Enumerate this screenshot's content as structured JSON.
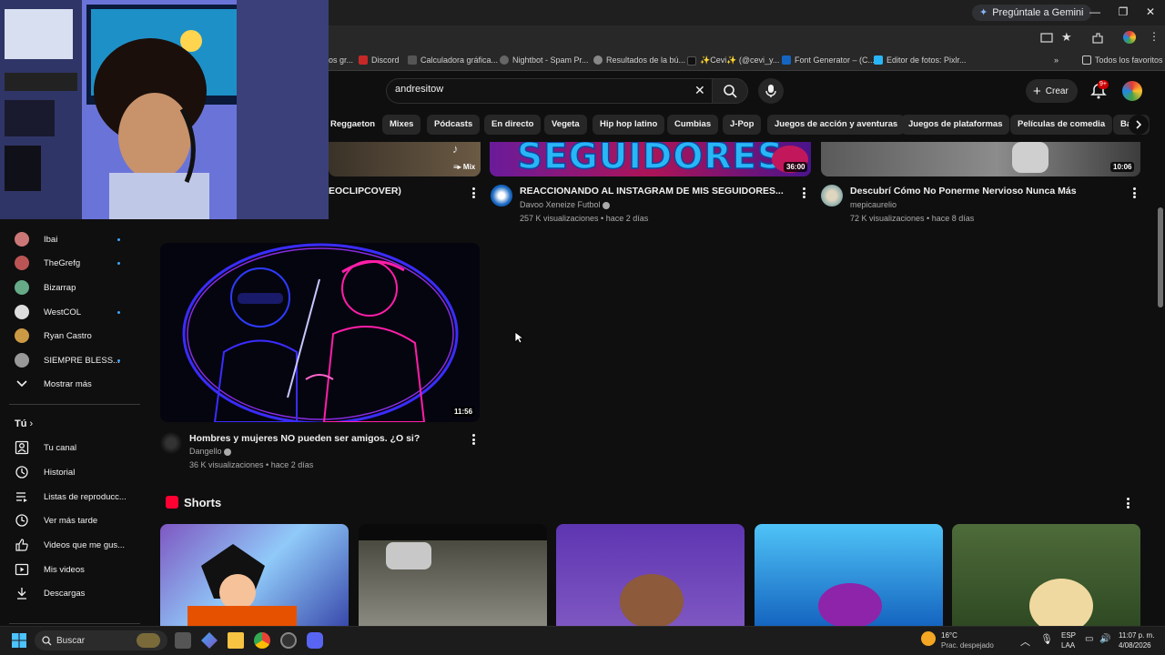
{
  "browser": {
    "gemini_label": "Pregúntale a Gemini",
    "bookmarks": [
      {
        "label": "os gr...",
        "color": "#444"
      },
      {
        "label": "Discord",
        "color": "#c62828"
      },
      {
        "label": "Calculadora gráfica...",
        "color": "#555"
      },
      {
        "label": "Nightbot - Spam Pr...",
        "color": "#666"
      },
      {
        "label": "Resultados de la bú...",
        "color": "#888"
      },
      {
        "label": "✨Cevi✨ (@cevi_y...",
        "color": "#111"
      },
      {
        "label": "Font Generator – (C...",
        "color": "#1565c0"
      },
      {
        "label": "Editor de fotos: Pixlr...",
        "color": "#29b6f6"
      }
    ],
    "all_bookmarks": "Todos los favoritos"
  },
  "header": {
    "search_value": "andresitow",
    "create_label": "Crear",
    "notif_badge": "9+"
  },
  "chips": [
    "Reggaeton",
    "Mixes",
    "Pódcasts",
    "En directo",
    "Vegeta",
    "Hip hop latino",
    "Cumbias",
    "J-Pop",
    "Juegos de acción y aventuras",
    "Juegos de plataformas",
    "Películas de comedia",
    "Ba"
  ],
  "sidebar": {
    "channels": [
      {
        "label": "Ibai",
        "live": true,
        "color": "#c77"
      },
      {
        "label": "TheGrefg",
        "live": true,
        "color": "#b55"
      },
      {
        "label": "Bizarrap",
        "live": false,
        "color": "#6a8"
      },
      {
        "label": "WestCOL",
        "live": true,
        "color": "#ddd"
      },
      {
        "label": "Ryan Castro",
        "live": false,
        "color": "#c94"
      },
      {
        "label": "SIEMPRE BLESS...",
        "live": true,
        "color": "#999"
      }
    ],
    "show_more": "Mostrar más",
    "you_heading": "Tú",
    "you_items": [
      {
        "label": "Tu canal",
        "icon": "channel-icon"
      },
      {
        "label": "Historial",
        "icon": "history-icon"
      },
      {
        "label": "Listas de reproducc...",
        "icon": "playlists-icon"
      },
      {
        "label": "Ver más tarde",
        "icon": "watch-later-icon"
      },
      {
        "label": "Videos que me gus...",
        "icon": "liked-icon"
      },
      {
        "label": "Mis videos",
        "icon": "my-videos-icon"
      },
      {
        "label": "Descargas",
        "icon": "downloads-icon"
      }
    ]
  },
  "videos_top": [
    {
      "title": "EOCLIPCOVER)",
      "badge": "Mix"
    },
    {
      "title": "REACCIONANDO AL INSTAGRAM DE MIS SEGUIDORES...",
      "channel": "Davoo Xeneize Futbol",
      "meta": "257 K visualizaciones • hace 2 días",
      "duration": "36:00",
      "thumb_text": "SEGUIDORES"
    },
    {
      "title": "Descubrí Cómo No Ponerme Nervioso Nunca Más",
      "channel": "mepicaurelio",
      "meta": "72 K visualizaciones • hace 8 días",
      "duration": "10:06"
    }
  ],
  "video_main": {
    "title": "Hombres y mujeres NO pueden ser amigos. ¿O si?",
    "channel": "Dangello",
    "meta": "36 K visualizaciones • hace 2 días",
    "duration": "11:56"
  },
  "shorts": {
    "heading": "Shorts"
  },
  "taskbar": {
    "search_label": "Buscar",
    "weather_temp": "16°C",
    "weather_desc": "Prac. despejado",
    "lang1": "ESP",
    "lang2": "LAA",
    "time": "11:07 p. m.",
    "date": "4/08/2026"
  }
}
